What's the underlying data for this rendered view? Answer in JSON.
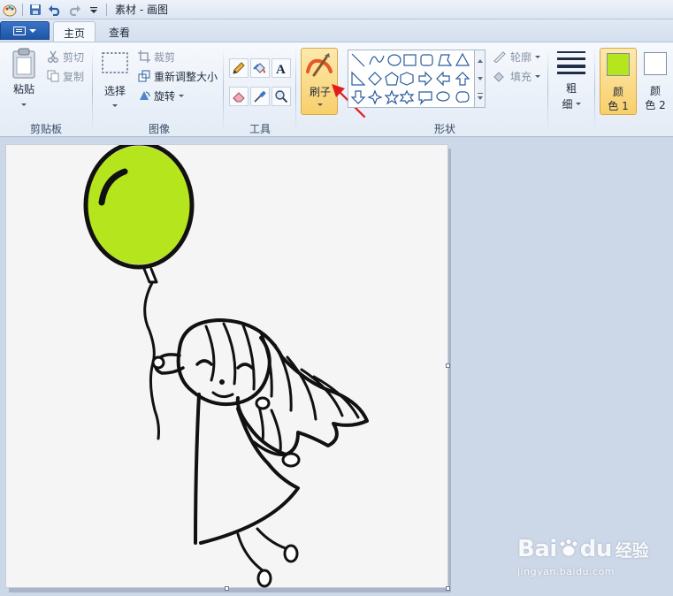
{
  "window": {
    "title": "素材 - 画图"
  },
  "quick_access": {
    "icons": [
      "paint-app-icon",
      "save-icon",
      "undo-icon",
      "redo-icon",
      "customize-dropdown-icon"
    ]
  },
  "tabs": [
    {
      "label": "主页",
      "active": true
    },
    {
      "label": "查看",
      "active": false
    }
  ],
  "ribbon": {
    "clipboard": {
      "paste": "粘贴",
      "cut": "剪切",
      "copy": "复制",
      "group_label": "剪贴板"
    },
    "image": {
      "select": "选择",
      "crop": "裁剪",
      "resize": "重新调整大小",
      "rotate": "旋转",
      "group_label": "图像"
    },
    "tools": {
      "group_label": "工具",
      "icons": [
        "pencil-icon",
        "fill-bucket-icon",
        "text-icon",
        "eraser-icon",
        "color-picker-icon",
        "magnifier-icon"
      ]
    },
    "brushes": {
      "label": "刷子"
    },
    "shapes": {
      "outline": "轮廓",
      "fill": "填充",
      "group_label": "形状"
    },
    "size": {
      "label_line1": "粗",
      "label_line2": "细"
    },
    "colors": {
      "color1_line1": "颜",
      "color1_line2": "色 1",
      "color2_line1": "颜",
      "color2_line2": "色 2",
      "color1_hex": "#b5e61d",
      "color2_hex": "#ffffff"
    }
  },
  "canvas": {
    "balloon_color": "#b5e61d",
    "background": "#f5f5f5"
  },
  "watermark": {
    "brand_latin": "Bai",
    "brand_latin2": "du",
    "brand_cn": "经验",
    "url": "jingyan.baidu.com"
  }
}
